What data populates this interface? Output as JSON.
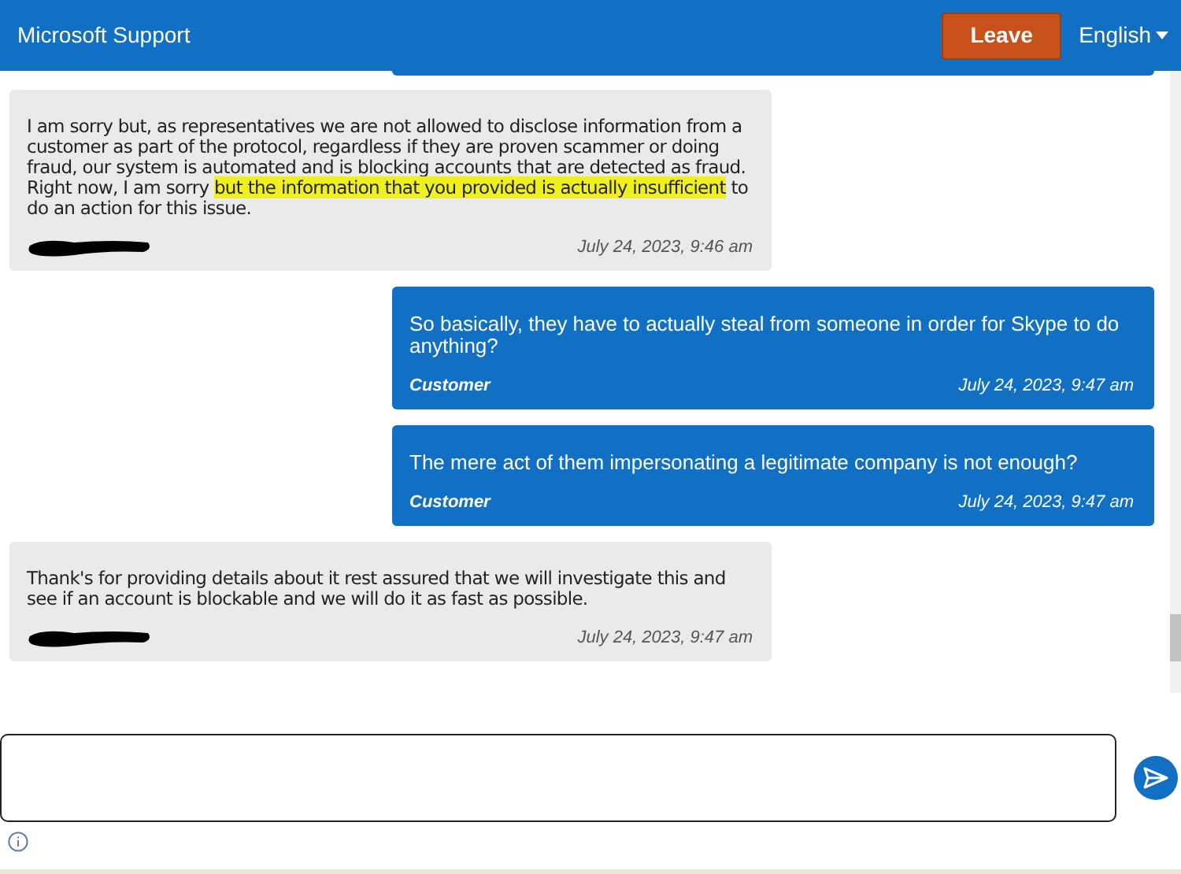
{
  "header": {
    "title": "Microsoft Support",
    "leave_button": "Leave",
    "language": "English"
  },
  "messages": [
    {
      "kind": "agent",
      "segments": [
        {
          "text": "I am sorry but, as representatives we are not allowed to disclose information from a customer as part of the protocol, regardless if they are proven scammer or doing fraud, our system is automated and is blocking accounts that are detected as fraud. Right now, I am sorry ",
          "highlighted": false
        },
        {
          "text": "but the information that you provided is actually insufficient",
          "highlighted": true
        },
        {
          "text": " to do an action for this issue.",
          "highlighted": false
        }
      ],
      "name_redacted": true,
      "time": "July 24, 2023, 9:46 am"
    },
    {
      "kind": "customer",
      "segments": [
        {
          "text": "So basically, they have to actually steal from someone in order for Skype to do anything?",
          "highlighted": false
        }
      ],
      "author": "Customer",
      "time": "July 24, 2023, 9:47 am"
    },
    {
      "kind": "customer",
      "segments": [
        {
          "text": "The mere act of them impersonating a legitimate company is not enough?",
          "highlighted": false
        }
      ],
      "author": "Customer",
      "time": "July 24, 2023, 9:47 am"
    },
    {
      "kind": "agent",
      "segments": [
        {
          "text": "Thank's for providing details about it rest assured that we will investigate this and see if an account is blockable and we will do it as fast as possible.",
          "highlighted": false
        }
      ],
      "name_redacted": true,
      "time": "July 24, 2023, 9:47 am"
    }
  ]
}
